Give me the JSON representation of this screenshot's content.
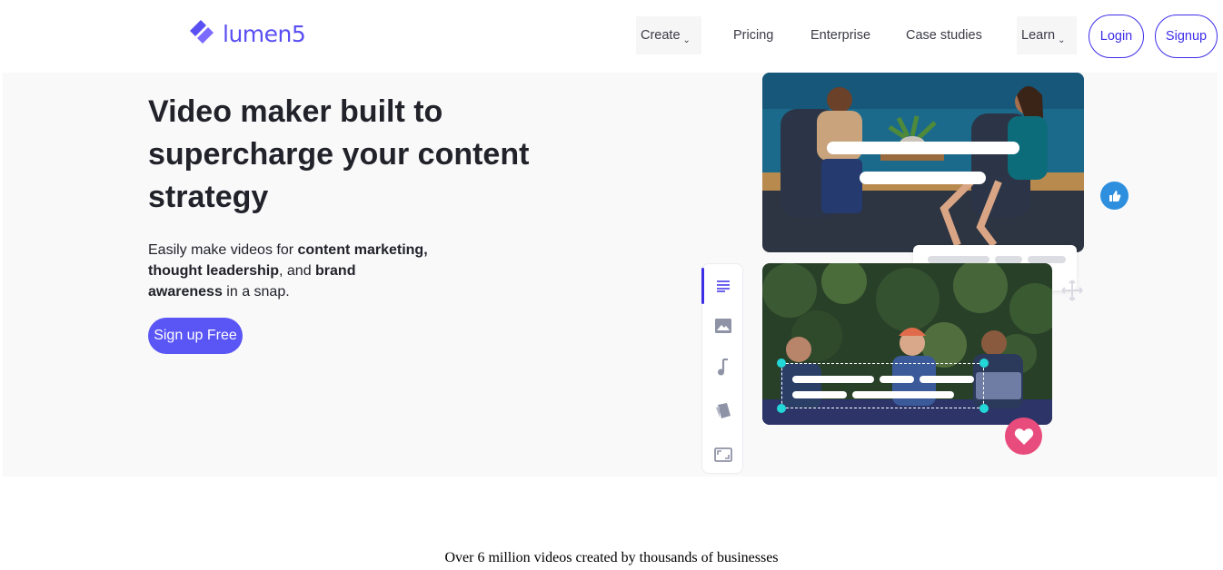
{
  "header": {
    "logo_text": "lumen5",
    "nav": [
      {
        "label": "Create",
        "dropdown": true
      },
      {
        "label": "Pricing"
      },
      {
        "label": "Enterprise"
      },
      {
        "label": "Case studies"
      },
      {
        "label": "Learn",
        "dropdown": true
      }
    ],
    "login_label": "Login",
    "signup_label": "Signup"
  },
  "hero": {
    "headline": "Video maker built to supercharge your content strategy",
    "sub_intro": "Easily make videos for ",
    "sub_bold_1": "content marketing, thought leadership",
    "sub_mid": ", and ",
    "sub_bold_2": "brand awareness",
    "sub_end": " in a snap.",
    "cta_label": "Sign up Free"
  },
  "editor_panel": {
    "tools": [
      "text-icon",
      "image-icon",
      "music-icon",
      "style-icon",
      "resize-icon"
    ]
  },
  "stats_text": "Over 6 million videos created by thousands of businesses",
  "colors": {
    "brand": "#5a4ff3",
    "accent": "#3d2ee8",
    "heart": "#e84c7d",
    "like": "#2d8fde",
    "handle": "#23d6d8"
  }
}
